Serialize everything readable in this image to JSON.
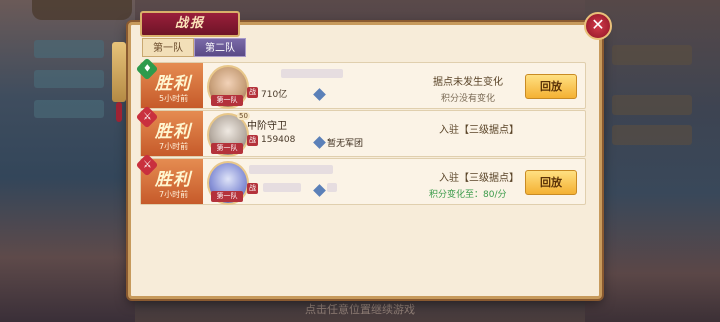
{
  "dialog": {
    "title": "战报",
    "close_symbol": "✕"
  },
  "tabs": [
    {
      "label": "第一队"
    },
    {
      "label": "第二队"
    }
  ],
  "reports": [
    {
      "result": "胜利",
      "time_ago": "5小时前",
      "team_tag": "第一队",
      "name": "",
      "power": "710亿",
      "legion": "",
      "status_main": "据点未发生变化",
      "status_sub": "积分没有变化",
      "button": "回放"
    },
    {
      "result": "胜利",
      "time_ago": "7小时前",
      "team_tag": "第一队",
      "level": "50",
      "name": "中阶守卫",
      "power": "159408",
      "legion": "暂无军团",
      "status_main": "入驻【三级据点】",
      "status_sub": "积分没有变化",
      "button": ""
    },
    {
      "result": "胜利",
      "time_ago": "7小时前",
      "team_tag": "第一队",
      "name": "",
      "power": "",
      "legion": "",
      "status_main": "入驻【三级据点】",
      "status_sub": "积分变化至：80/分",
      "button": "回放"
    }
  ],
  "bottom_hint": "点击任意位置继续游戏",
  "colors": {
    "accent_tab": "#5a4a86",
    "win_badge": "#c65a2a",
    "button": "#f4b133",
    "score_green": "#3a9b4a"
  }
}
